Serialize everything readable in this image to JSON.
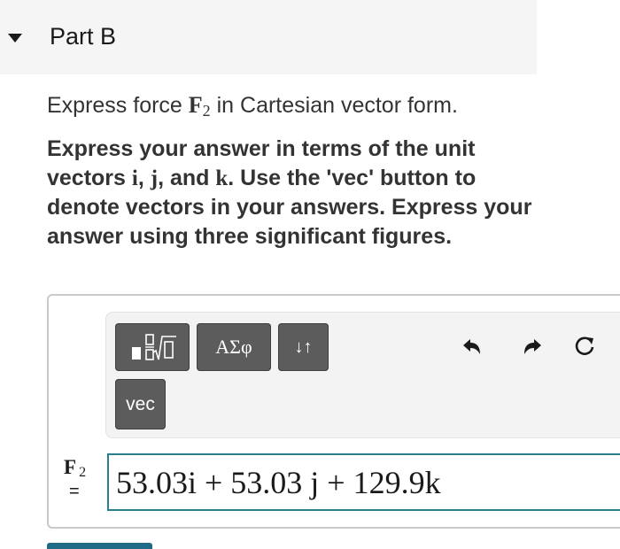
{
  "part": {
    "title": "Part B",
    "caret_icon": "caret-down-icon"
  },
  "prompt": {
    "lead": "Express force ",
    "vector": "F",
    "subscript": "2",
    "tail": " in Cartesian vector form."
  },
  "instructions": {
    "p1": "Express your answer in terms of the unit vectors ",
    "i": "i",
    "sep1": ", ",
    "j": "j",
    "sep2": ", and ",
    "k": "k",
    "p2": ". Use the 'vec' button to denote vectors in your answers. Express your answer using three significant figures."
  },
  "toolbar": {
    "templates_icon": "templates-sqrt-icon",
    "greek_label": "ΑΣφ",
    "arrows_label": "↓↑",
    "vec_label": "vec",
    "undo_icon": "undo-icon",
    "redo_icon": "redo-icon",
    "reset_icon": "reset-icon"
  },
  "answer": {
    "variable": "F",
    "variable_subscript": "2",
    "equals": "=",
    "value": "53.03i + 53.03 j + 129.9k"
  },
  "colors": {
    "header_bg": "#f5f5f5",
    "button_bg": "#5c5c5c",
    "input_border": "#2a7f8c",
    "submit": "#1f6a84"
  }
}
